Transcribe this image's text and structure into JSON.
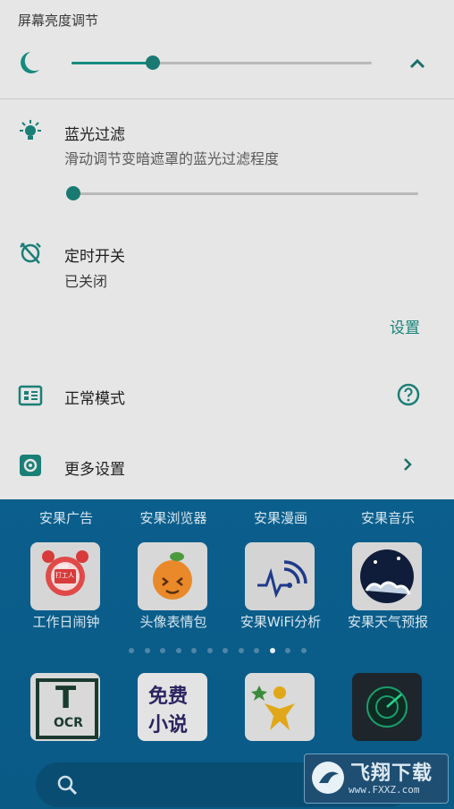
{
  "panel": {
    "brightness_title": "屏幕亮度调节",
    "brightness_level": 0.27,
    "blue_filter": {
      "title": "蓝光过滤",
      "subtitle": "滑动调节变暗遮罩的蓝光过滤程度",
      "level": 0.0
    },
    "timer": {
      "title": "定时开关",
      "status": "已关闭",
      "settings_link": "设置"
    },
    "normal_mode": "正常模式",
    "more_settings": "更多设置",
    "accent_color": "#178478"
  },
  "home": {
    "top_labels": [
      "安果广告",
      "安果浏览器",
      "安果漫画",
      "安果音乐"
    ],
    "apps_row1": [
      {
        "label": "工作日闹钟",
        "icon": "alarm-clock-icon",
        "badge": "打工人",
        "badge_small": "998"
      },
      {
        "label": "头像表情包",
        "icon": "orange-face-icon"
      },
      {
        "label": "安果WiFi分析",
        "icon": "wifi-analyzer-icon"
      },
      {
        "label": "安果天气预报",
        "icon": "weather-moon-icon"
      }
    ],
    "page_dots": {
      "count": 12,
      "active_index": 9
    },
    "apps_row2": [
      {
        "icon": "ocr-icon",
        "big": "T",
        "small": "OCR"
      },
      {
        "icon": "free-novel-icon",
        "line1": "免费",
        "line2": "小说"
      },
      {
        "icon": "star-person-icon"
      },
      {
        "icon": "radar-icon"
      }
    ]
  },
  "watermark": {
    "title": "飞翔下载",
    "url": "www.FXXZ.com"
  }
}
